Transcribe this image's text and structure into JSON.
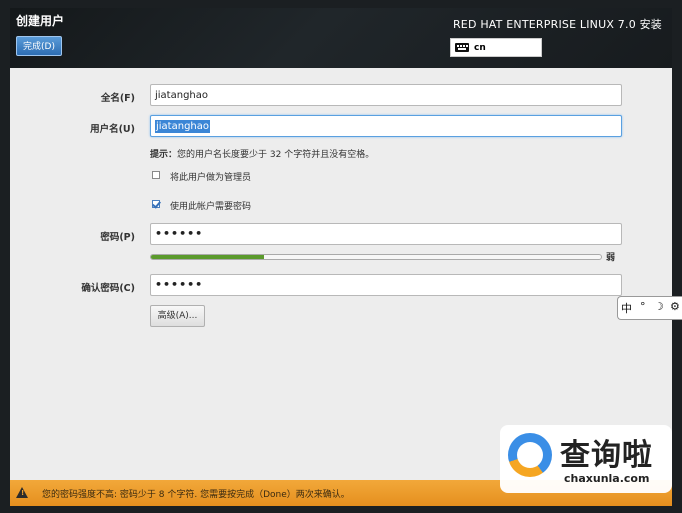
{
  "header": {
    "title": "创建用户",
    "done_label": "完成(D)",
    "product": "RED HAT ENTERPRISE LINUX 7.0 安装",
    "keyboard_layout": "cn"
  },
  "form": {
    "fullname_label": "全名(F)",
    "fullname_value": "jiatanghao",
    "username_label": "用户名(U)",
    "username_value": "jiatanghao",
    "hint_prefix": "提示：",
    "hint_text": "您的用户名长度要少于 32 个字符并且没有空格。",
    "admin_checkbox_label": "将此用户做为管理员",
    "admin_checked": false,
    "require_password_label": "使用此帐户需要密码",
    "require_password_checked": true,
    "password_label": "密码(P)",
    "password_value": "••••••",
    "strength_label": "弱",
    "strength_level": 0.25,
    "confirm_label": "确认密码(C)",
    "confirm_value": "••••••",
    "advanced_label": "高级(A)..."
  },
  "warning": {
    "text": "您的密码强度不高: 密码少于 8 个字符. 您需要按完成（Done）两次来确认。"
  },
  "ime": {
    "items": [
      "中",
      "°",
      "☽",
      "⚙"
    ]
  },
  "watermark": {
    "main": "查询啦",
    "sub": "chaxunla.com"
  },
  "colors": {
    "accent_blue": "#2d6db3",
    "warning_orange": "#e58f1e",
    "strength_green": "#5b9a2c"
  }
}
